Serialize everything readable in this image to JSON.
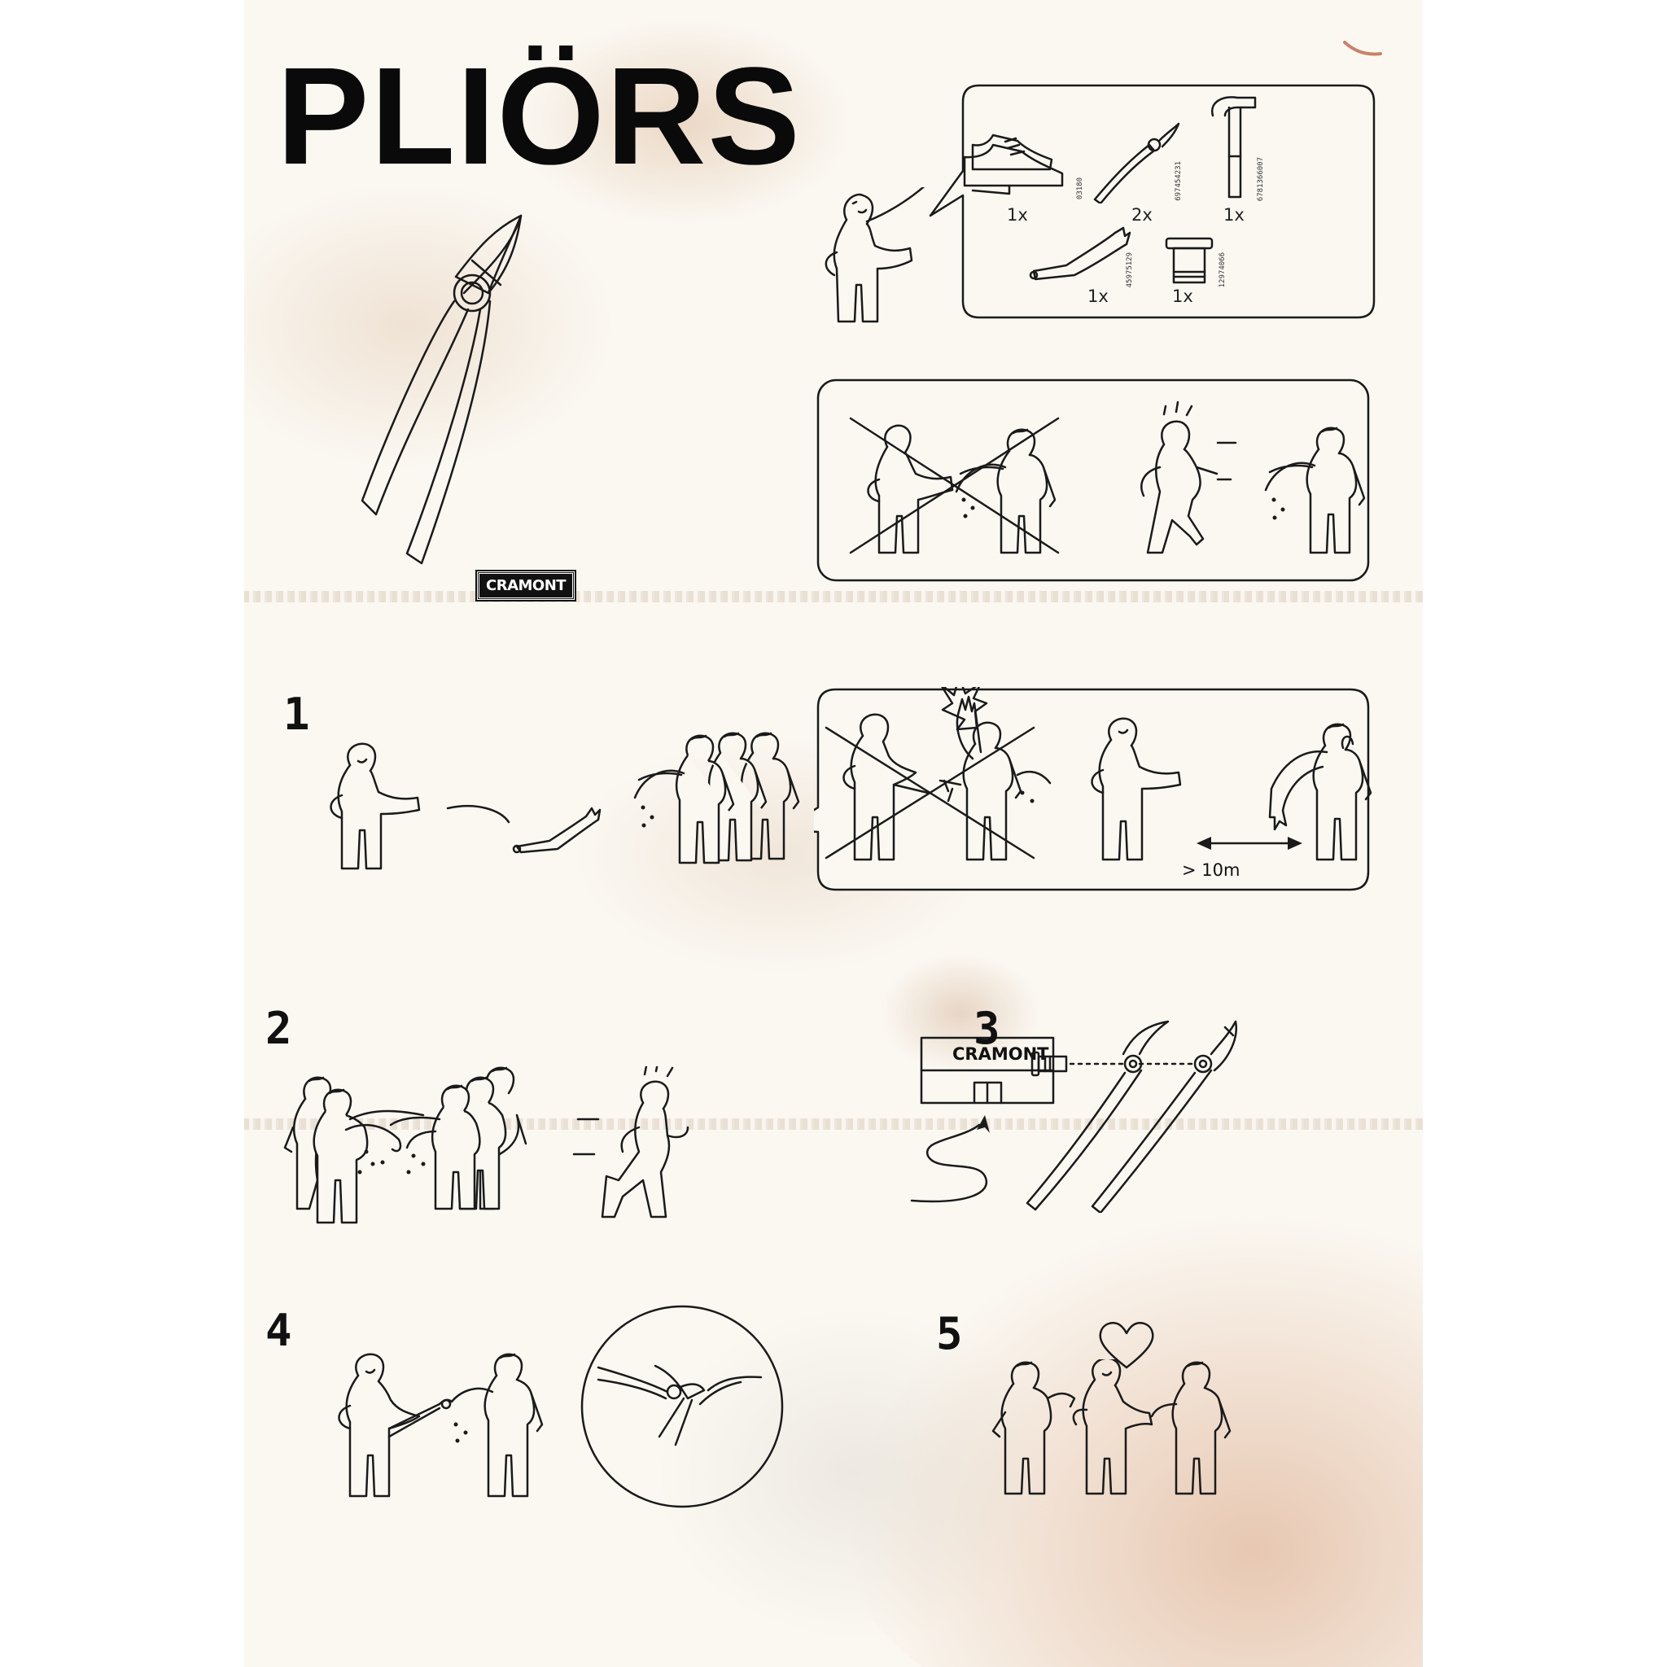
{
  "title": "PLIÖRS",
  "brand": "CRAMONT",
  "parts": [
    {
      "name": "shoes",
      "qty": "1x",
      "part_no": "03180"
    },
    {
      "name": "pliers-half",
      "qty": "2x",
      "part_no": "697454231"
    },
    {
      "name": "hammer",
      "qty": "1x",
      "part_no": "6781366007"
    },
    {
      "name": "arm",
      "qty": "1x",
      "part_no": "45975129"
    },
    {
      "name": "bolt",
      "qty": "1x",
      "part_no": "12974066"
    }
  ],
  "steps": {
    "s1": "1",
    "s2": "2",
    "s3": "3",
    "s4": "4",
    "s5": "5"
  },
  "distance_label": "> 10m",
  "shop_sign": "CRAMONT",
  "icons": [
    "pliers-icon",
    "person-icon",
    "zombie-icon",
    "heart-icon",
    "arrow-icon",
    "hammer-icon",
    "bolt-icon",
    "shoes-icon",
    "arm-icon",
    "explosion-icon"
  ],
  "colors": {
    "paper": "#fbf8f2",
    "ink": "#1a1a1a",
    "stain": "#d9a98a"
  }
}
